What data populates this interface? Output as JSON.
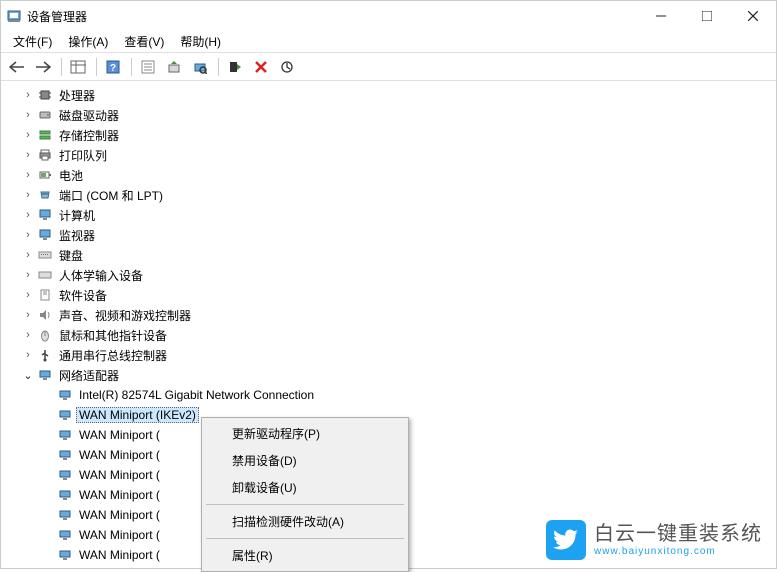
{
  "window": {
    "title": "设备管理器"
  },
  "menubar": {
    "file": "文件(F)",
    "action": "操作(A)",
    "view": "查看(V)",
    "help": "帮助(H)"
  },
  "tree": {
    "items": [
      {
        "label": "处理器",
        "expanded": false
      },
      {
        "label": "磁盘驱动器",
        "expanded": false
      },
      {
        "label": "存储控制器",
        "expanded": false
      },
      {
        "label": "打印队列",
        "expanded": false
      },
      {
        "label": "电池",
        "expanded": false
      },
      {
        "label": "端口 (COM 和 LPT)",
        "expanded": false
      },
      {
        "label": "计算机",
        "expanded": false
      },
      {
        "label": "监视器",
        "expanded": false
      },
      {
        "label": "键盘",
        "expanded": false
      },
      {
        "label": "人体学输入设备",
        "expanded": false
      },
      {
        "label": "软件设备",
        "expanded": false
      },
      {
        "label": "声音、视频和游戏控制器",
        "expanded": false
      },
      {
        "label": "鼠标和其他指针设备",
        "expanded": false
      },
      {
        "label": "通用串行总线控制器",
        "expanded": false
      },
      {
        "label": "网络适配器",
        "expanded": true
      }
    ],
    "network_children": [
      {
        "label": "Intel(R) 82574L Gigabit Network Connection",
        "selected": false
      },
      {
        "label": "WAN Miniport (IKEv2)",
        "selected": true
      },
      {
        "label": "WAN Miniport (",
        "selected": false
      },
      {
        "label": "WAN Miniport (",
        "selected": false
      },
      {
        "label": "WAN Miniport (",
        "selected": false
      },
      {
        "label": "WAN Miniport (",
        "selected": false
      },
      {
        "label": "WAN Miniport (",
        "selected": false
      },
      {
        "label": "WAN Miniport (",
        "selected": false
      },
      {
        "label": "WAN Miniport (",
        "selected": false
      }
    ]
  },
  "context_menu": {
    "update": "更新驱动程序(P)",
    "disable": "禁用设备(D)",
    "uninstall": "卸载设备(U)",
    "scan": "扫描检测硬件改动(A)",
    "properties": "属性(R)"
  },
  "brand": {
    "title": "白云一键重装系统",
    "url": "www.baiyunxitong.com"
  }
}
